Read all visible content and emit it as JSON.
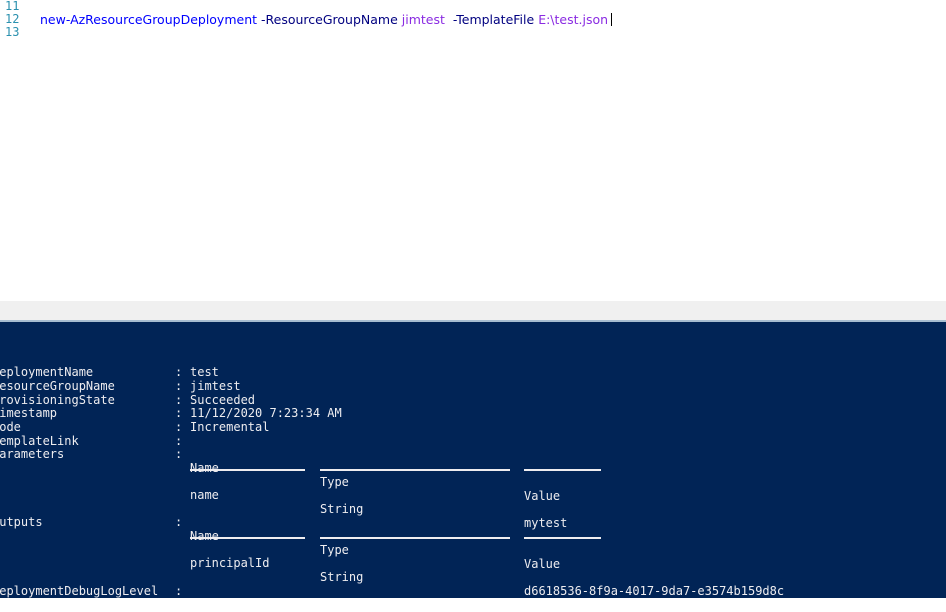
{
  "editor": {
    "line_numbers": [
      "11",
      "12",
      "13"
    ],
    "line12": {
      "cmdlet": "new-AzResourceGroupDeployment",
      "param1": "-ResourceGroupName",
      "value1": "jimtest",
      "param2": "-TemplateFile",
      "value2": "E:\\test.json"
    }
  },
  "console": {
    "props": [
      {
        "key": "DeploymentName",
        "value": "test"
      },
      {
        "key": "ResourceGroupName",
        "value": "jimtest"
      },
      {
        "key": "ProvisioningState",
        "value": "Succeeded"
      },
      {
        "key": "Timestamp",
        "value": "11/12/2020 7:23:34 AM"
      },
      {
        "key": "Mode",
        "value": "Incremental"
      },
      {
        "key": "TemplateLink",
        "value": ""
      },
      {
        "key": "Parameters",
        "value": ""
      }
    ],
    "parameters_table": {
      "headers": [
        "Name",
        "Type",
        "Value"
      ],
      "rows": [
        [
          "name",
          "String",
          "mytest"
        ]
      ]
    },
    "outputs_key": "Outputs",
    "outputs_table": {
      "headers": [
        "Name",
        "Type",
        "Value"
      ],
      "rows": [
        [
          "principalId",
          "String",
          "d6618536-8f9a-4017-9da7-e3574b159d8c"
        ]
      ]
    },
    "debug_key": "DeploymentDebugLogLevel",
    "separator": ":"
  },
  "colors": {
    "console_bg": "#012456",
    "console_fg": "#eeedf0",
    "line_number": "#2b91af",
    "cmdlet": "#0000ff",
    "param": "#000080",
    "string": "#8a2be2"
  }
}
